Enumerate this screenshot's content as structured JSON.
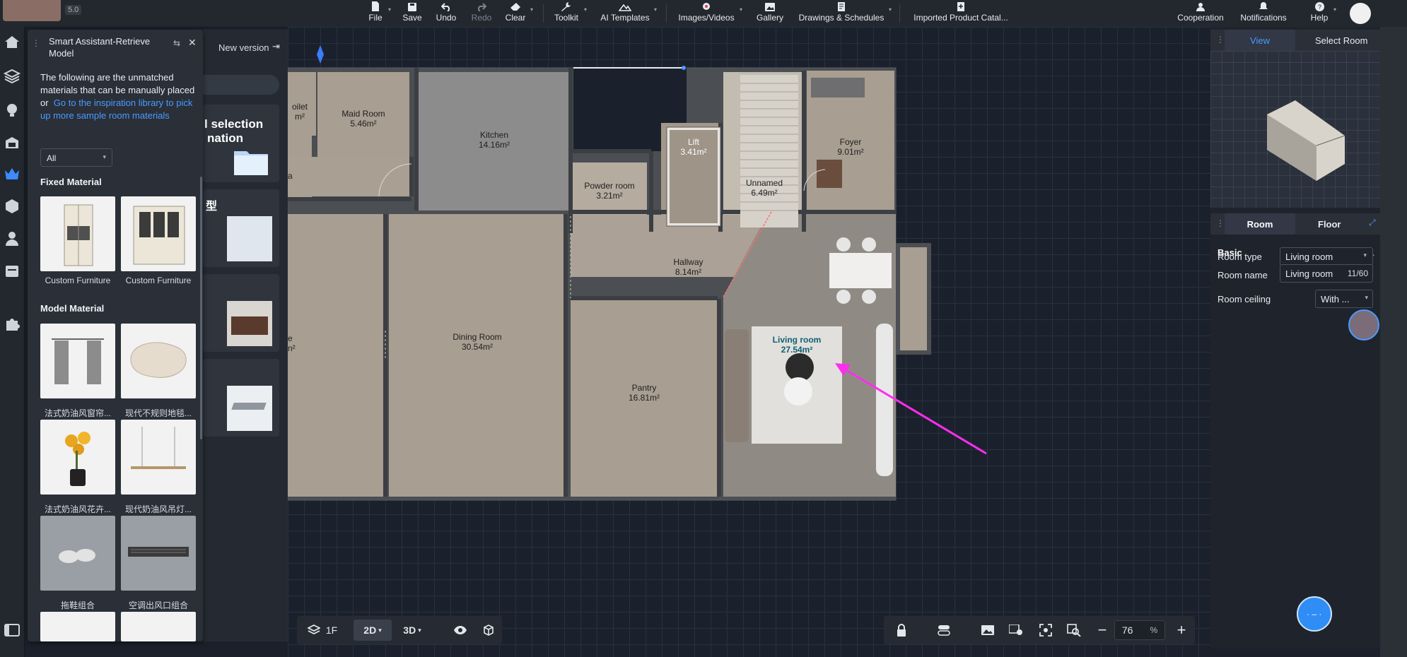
{
  "user": {
    "rating": "5.0"
  },
  "topbar": {
    "file": "File",
    "save": "Save",
    "undo": "Undo",
    "redo": "Redo",
    "clear": "Clear",
    "toolkit": "Toolkit",
    "ai_templates": "AI Templates",
    "images_videos": "Images/Videos",
    "gallery": "Gallery",
    "drawings": "Drawings & Schedules",
    "imported": "Imported Product Catal...",
    "cooperation": "Cooperation",
    "notifications": "Notifications",
    "help": "Help"
  },
  "assistant": {
    "title": "Smart Assistant-Retrieve Model",
    "description": "The following are the unmatched materials that can be manually placed",
    "or": "or",
    "link": "Go to the inspiration library to pick up more sample room materials",
    "filter": "All",
    "fixed_title": "Fixed Material",
    "fixed_items": [
      "Custom Furniture",
      "Custom Furniture"
    ],
    "model_title": "Model Material",
    "model_items": [
      "法式奶油风窗帘...",
      "现代不规则地毯...",
      "法式奶油风花卉...",
      "现代奶油风吊灯...",
      "拖鞋组合",
      "空调出风口组合"
    ]
  },
  "behind": {
    "new_version": "New version",
    "selection": "l selection",
    "nation": "nation",
    "model_char": "型"
  },
  "rooms": [
    {
      "name": "oilet",
      "area": "m²"
    },
    {
      "name": "Maid Room",
      "area": "5.46m²"
    },
    {
      "name": "Kitchen",
      "area": "14.16m²"
    },
    {
      "name": "Powder room",
      "area": "3.21m²"
    },
    {
      "name": "Lift",
      "area": "3.41m²"
    },
    {
      "name": "Unnamed",
      "area": "6.49m²"
    },
    {
      "name": "Foyer",
      "area": "9.01m²"
    },
    {
      "name": "Hallway",
      "area": "8.14m²"
    },
    {
      "name": "Dining Room",
      "area": "30.54m²"
    },
    {
      "name": "Pantry",
      "area": "16.81m²"
    },
    {
      "name": "Living room",
      "area": "27.54m²"
    },
    {
      "name": "a",
      "area": ""
    },
    {
      "name": "e",
      "area": "n²"
    }
  ],
  "right_panel": {
    "view": "View",
    "select_room": "Select Room",
    "tab_room": "Room",
    "tab_floor": "Floor",
    "basic": "Basic",
    "room_type_label": "Room type",
    "room_type_value": "Living room",
    "room_name_label": "Room name",
    "room_name_value": "Living room",
    "room_name_count": "11/60",
    "ceiling_label": "Room ceiling",
    "ceiling_value": "With ..."
  },
  "bottom": {
    "floor": "1F",
    "mode_2d": "2D",
    "mode_3d": "3D",
    "zoom": "76",
    "zoom_unit": "%"
  },
  "colors": {
    "accent": "#4a9bff",
    "annotation": "#ff2df0",
    "floor": "#a89e91",
    "wall": "#4b4e52"
  }
}
